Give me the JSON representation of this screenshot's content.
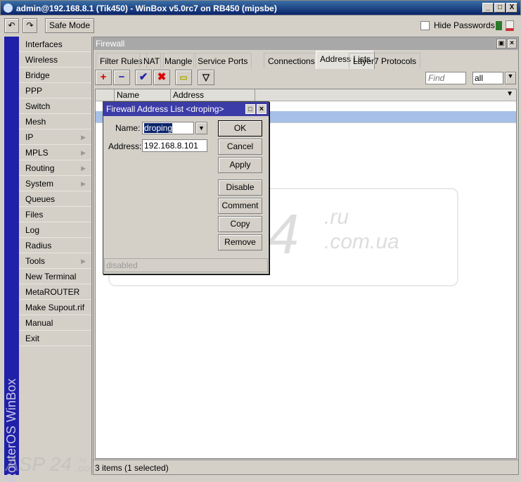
{
  "window": {
    "title": "admin@192.168.8.1 (Tik450) - WinBox v5.0rc7 on RB450 (mipsbe)",
    "min": "_",
    "max": "□",
    "close": "X"
  },
  "toolbar": {
    "undo": "↶",
    "redo": "↷",
    "safe_mode": "Safe Mode",
    "hide_passwords": "Hide Passwords",
    "hide_passwords_checked": false
  },
  "sidebar": {
    "brand": "RouterOS WinBox",
    "items": [
      {
        "label": "Interfaces"
      },
      {
        "label": "Wireless"
      },
      {
        "label": "Bridge"
      },
      {
        "label": "PPP"
      },
      {
        "label": "Switch"
      },
      {
        "label": "Mesh"
      },
      {
        "label": "IP",
        "submenu": true
      },
      {
        "label": "MPLS",
        "submenu": true
      },
      {
        "label": "Routing",
        "submenu": true
      },
      {
        "label": "System",
        "submenu": true
      },
      {
        "label": "Queues"
      },
      {
        "label": "Files"
      },
      {
        "label": "Log"
      },
      {
        "label": "Radius"
      },
      {
        "label": "Tools",
        "submenu": true
      },
      {
        "label": "New Terminal"
      },
      {
        "label": "MetaROUTER"
      },
      {
        "label": "Make Supout.rif"
      },
      {
        "label": "Manual"
      },
      {
        "label": "Exit"
      }
    ]
  },
  "firewall": {
    "title": "Firewall",
    "tabs": [
      "Filter Rules",
      "NAT",
      "Mangle",
      "Service Ports",
      "Connections",
      "Address Lists",
      "Layer7 Protocols"
    ],
    "active_tab": "Address Lists",
    "find_placeholder": "Find",
    "filter_value": "all",
    "columns": [
      "Name",
      "Address"
    ],
    "status": "3 items (1 selected)"
  },
  "dialog": {
    "title": "Firewall Address List <droping>",
    "name_label": "Name:",
    "name_value": "droping",
    "address_label": "Address:",
    "address_value": "192.168.8.101",
    "buttons": {
      "ok": "OK",
      "cancel": "Cancel",
      "apply": "Apply",
      "disable": "Disable",
      "comment": "Comment",
      "copy": "Copy",
      "remove": "Remove"
    },
    "status": "disabled"
  },
  "watermark": {
    "main": "ASP24",
    "ru": ".ru",
    "comua": ".com.ua",
    "small": "ASP 24",
    "small_ru": ".ru",
    "small_com": ".com"
  },
  "colors": {
    "accent": "#0a246a",
    "selected_row": "#a6c0e8",
    "sidebar_strip": "#2020a8"
  }
}
